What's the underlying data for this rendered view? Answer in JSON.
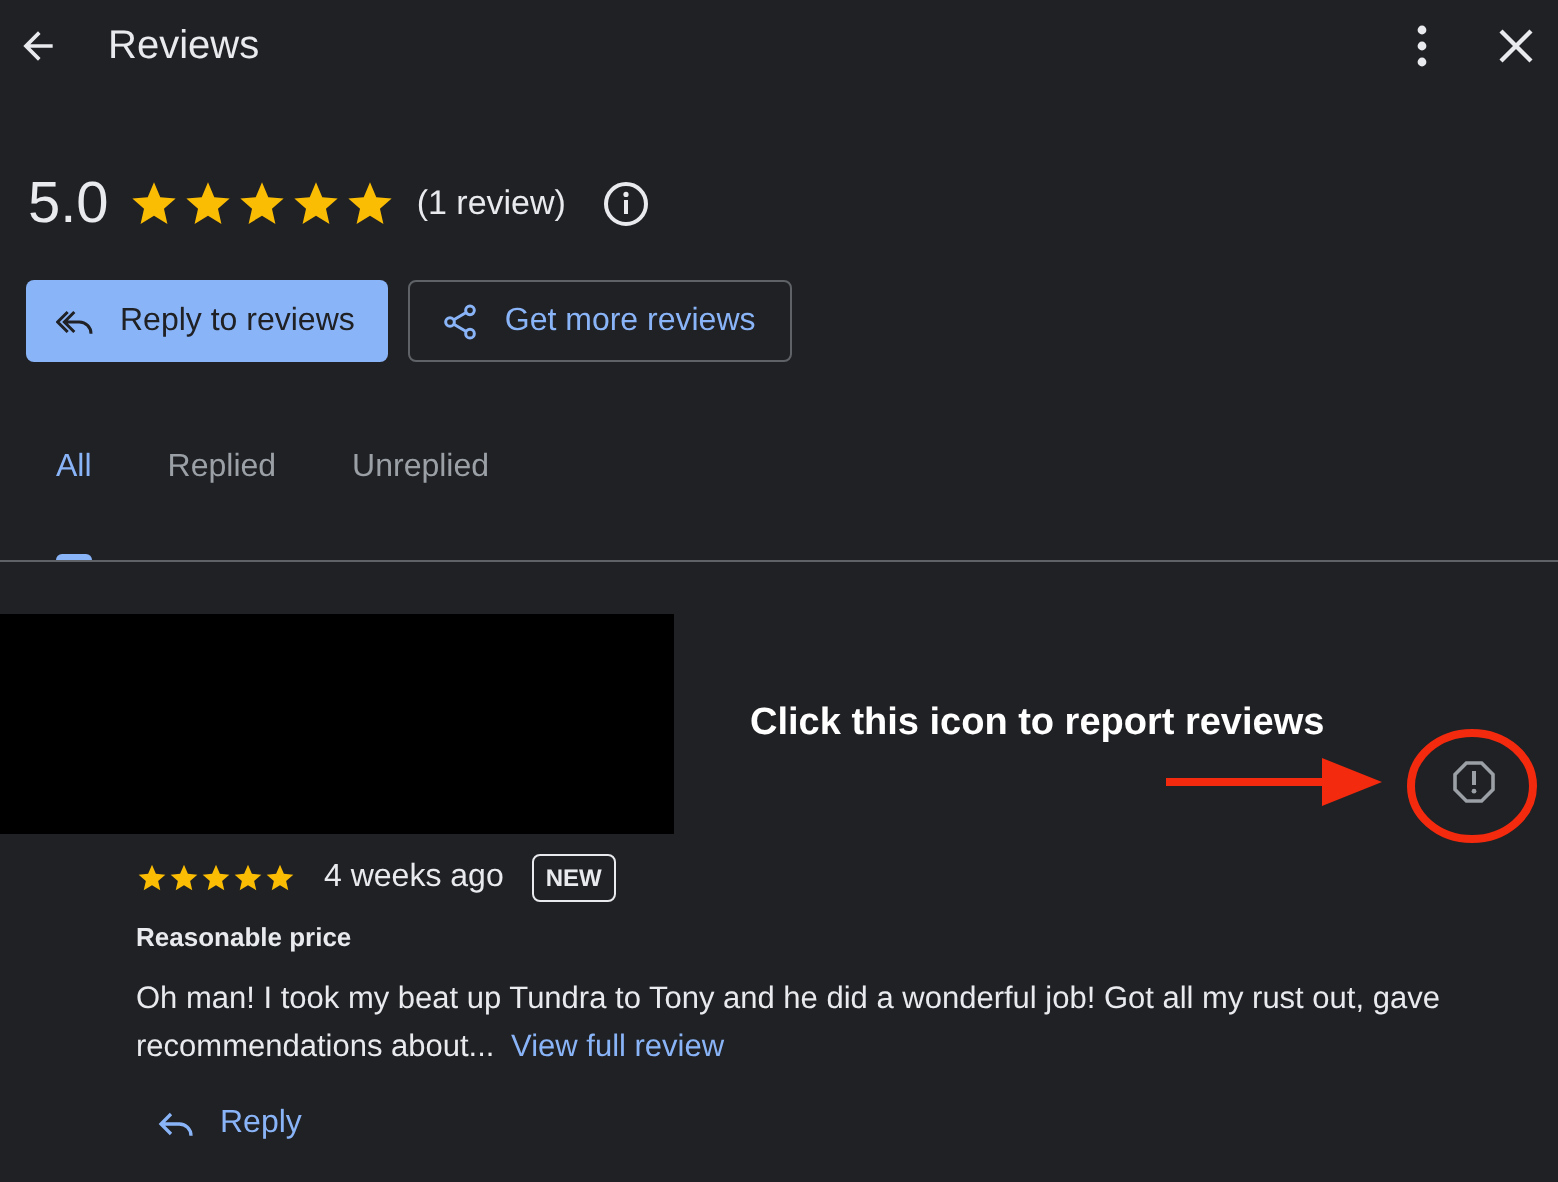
{
  "header": {
    "title": "Reviews"
  },
  "summary": {
    "rating": "5.0",
    "stars": 5,
    "count": "(1 review)"
  },
  "actions": [
    {
      "label": "Reply to reviews",
      "kind": "primary"
    },
    {
      "label": "Get more reviews",
      "kind": "outline"
    }
  ],
  "tabs": [
    {
      "label": "All",
      "selected": true
    },
    {
      "label": "Replied",
      "selected": false
    },
    {
      "label": "Unreplied",
      "selected": false
    }
  ],
  "reviews": [
    {
      "stars": 5,
      "time": "4 weeks ago",
      "badge": "NEW",
      "title": "Reasonable price",
      "text": "Oh man! I took my beat up Tundra to Tony and he did a wonderful job! Got all my rust out, gave recommendations about...",
      "link": "View full review",
      "reply": "Reply"
    }
  ],
  "annotation": {
    "text": "Click this icon to report reviews"
  }
}
